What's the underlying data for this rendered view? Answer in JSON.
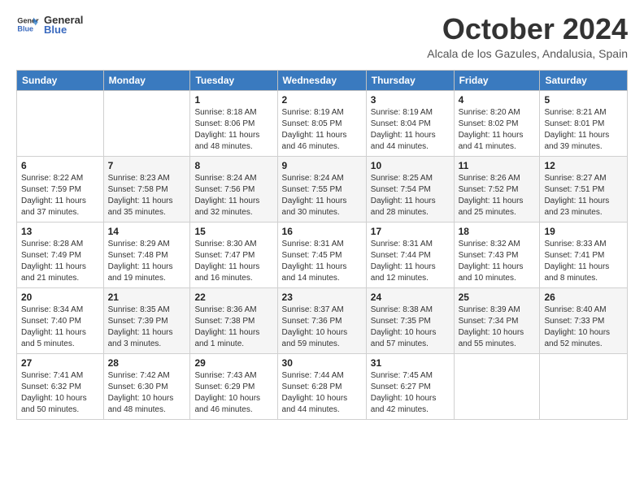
{
  "logo": {
    "general": "General",
    "blue": "Blue"
  },
  "header": {
    "month": "October 2024",
    "location": "Alcala de los Gazules, Andalusia, Spain"
  },
  "weekdays": [
    "Sunday",
    "Monday",
    "Tuesday",
    "Wednesday",
    "Thursday",
    "Friday",
    "Saturday"
  ],
  "weeks": [
    [
      {
        "day": "",
        "info": ""
      },
      {
        "day": "",
        "info": ""
      },
      {
        "day": "1",
        "info": "Sunrise: 8:18 AM\nSunset: 8:06 PM\nDaylight: 11 hours and 48 minutes."
      },
      {
        "day": "2",
        "info": "Sunrise: 8:19 AM\nSunset: 8:05 PM\nDaylight: 11 hours and 46 minutes."
      },
      {
        "day": "3",
        "info": "Sunrise: 8:19 AM\nSunset: 8:04 PM\nDaylight: 11 hours and 44 minutes."
      },
      {
        "day": "4",
        "info": "Sunrise: 8:20 AM\nSunset: 8:02 PM\nDaylight: 11 hours and 41 minutes."
      },
      {
        "day": "5",
        "info": "Sunrise: 8:21 AM\nSunset: 8:01 PM\nDaylight: 11 hours and 39 minutes."
      }
    ],
    [
      {
        "day": "6",
        "info": "Sunrise: 8:22 AM\nSunset: 7:59 PM\nDaylight: 11 hours and 37 minutes."
      },
      {
        "day": "7",
        "info": "Sunrise: 8:23 AM\nSunset: 7:58 PM\nDaylight: 11 hours and 35 minutes."
      },
      {
        "day": "8",
        "info": "Sunrise: 8:24 AM\nSunset: 7:56 PM\nDaylight: 11 hours and 32 minutes."
      },
      {
        "day": "9",
        "info": "Sunrise: 8:24 AM\nSunset: 7:55 PM\nDaylight: 11 hours and 30 minutes."
      },
      {
        "day": "10",
        "info": "Sunrise: 8:25 AM\nSunset: 7:54 PM\nDaylight: 11 hours and 28 minutes."
      },
      {
        "day": "11",
        "info": "Sunrise: 8:26 AM\nSunset: 7:52 PM\nDaylight: 11 hours and 25 minutes."
      },
      {
        "day": "12",
        "info": "Sunrise: 8:27 AM\nSunset: 7:51 PM\nDaylight: 11 hours and 23 minutes."
      }
    ],
    [
      {
        "day": "13",
        "info": "Sunrise: 8:28 AM\nSunset: 7:49 PM\nDaylight: 11 hours and 21 minutes."
      },
      {
        "day": "14",
        "info": "Sunrise: 8:29 AM\nSunset: 7:48 PM\nDaylight: 11 hours and 19 minutes."
      },
      {
        "day": "15",
        "info": "Sunrise: 8:30 AM\nSunset: 7:47 PM\nDaylight: 11 hours and 16 minutes."
      },
      {
        "day": "16",
        "info": "Sunrise: 8:31 AM\nSunset: 7:45 PM\nDaylight: 11 hours and 14 minutes."
      },
      {
        "day": "17",
        "info": "Sunrise: 8:31 AM\nSunset: 7:44 PM\nDaylight: 11 hours and 12 minutes."
      },
      {
        "day": "18",
        "info": "Sunrise: 8:32 AM\nSunset: 7:43 PM\nDaylight: 11 hours and 10 minutes."
      },
      {
        "day": "19",
        "info": "Sunrise: 8:33 AM\nSunset: 7:41 PM\nDaylight: 11 hours and 8 minutes."
      }
    ],
    [
      {
        "day": "20",
        "info": "Sunrise: 8:34 AM\nSunset: 7:40 PM\nDaylight: 11 hours and 5 minutes."
      },
      {
        "day": "21",
        "info": "Sunrise: 8:35 AM\nSunset: 7:39 PM\nDaylight: 11 hours and 3 minutes."
      },
      {
        "day": "22",
        "info": "Sunrise: 8:36 AM\nSunset: 7:38 PM\nDaylight: 11 hours and 1 minute."
      },
      {
        "day": "23",
        "info": "Sunrise: 8:37 AM\nSunset: 7:36 PM\nDaylight: 10 hours and 59 minutes."
      },
      {
        "day": "24",
        "info": "Sunrise: 8:38 AM\nSunset: 7:35 PM\nDaylight: 10 hours and 57 minutes."
      },
      {
        "day": "25",
        "info": "Sunrise: 8:39 AM\nSunset: 7:34 PM\nDaylight: 10 hours and 55 minutes."
      },
      {
        "day": "26",
        "info": "Sunrise: 8:40 AM\nSunset: 7:33 PM\nDaylight: 10 hours and 52 minutes."
      }
    ],
    [
      {
        "day": "27",
        "info": "Sunrise: 7:41 AM\nSunset: 6:32 PM\nDaylight: 10 hours and 50 minutes."
      },
      {
        "day": "28",
        "info": "Sunrise: 7:42 AM\nSunset: 6:30 PM\nDaylight: 10 hours and 48 minutes."
      },
      {
        "day": "29",
        "info": "Sunrise: 7:43 AM\nSunset: 6:29 PM\nDaylight: 10 hours and 46 minutes."
      },
      {
        "day": "30",
        "info": "Sunrise: 7:44 AM\nSunset: 6:28 PM\nDaylight: 10 hours and 44 minutes."
      },
      {
        "day": "31",
        "info": "Sunrise: 7:45 AM\nSunset: 6:27 PM\nDaylight: 10 hours and 42 minutes."
      },
      {
        "day": "",
        "info": ""
      },
      {
        "day": "",
        "info": ""
      }
    ]
  ]
}
